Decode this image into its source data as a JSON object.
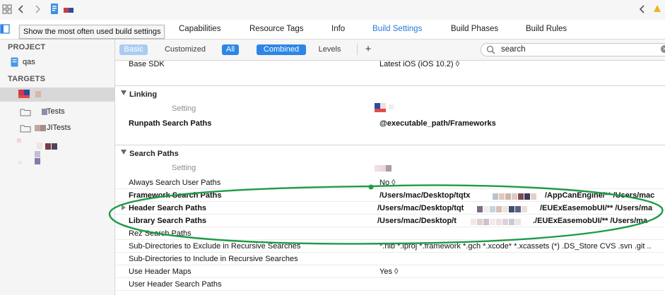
{
  "toolbar": {
    "icons": [
      "grid-icon",
      "back-chevron-icon",
      "forward-chevron-icon",
      "file-icon",
      "back-chevron-right-icon"
    ]
  },
  "tabs": [
    {
      "label": "Capabilities"
    },
    {
      "label": "Resource Tags"
    },
    {
      "label": "Info"
    },
    {
      "label": "Build Settings",
      "active": true
    },
    {
      "label": "Build Phases"
    },
    {
      "label": "Build Rules"
    }
  ],
  "tooltip": "Show the most often used build settings",
  "sidebar": {
    "project_header": "PROJECT",
    "project_item": "qas",
    "targets_header": "TARGETS",
    "targets": [
      {
        "label": ""
      },
      {
        "label": "Tests"
      },
      {
        "label": "JITests"
      }
    ]
  },
  "filter": {
    "basic": "Basic",
    "customized": "Customized",
    "all": "All",
    "combined": "Combined",
    "levels": "Levels",
    "add": "+",
    "search_value": "search"
  },
  "settings": {
    "base_sdk_label": "Base SDK",
    "base_sdk_value": "Latest iOS (iOS 10.2) ◊",
    "linking": {
      "header": "Linking",
      "setting_label": "Setting",
      "runpath_label": "Runpath Search Paths",
      "runpath_value": "@executable_path/Frameworks"
    },
    "search_paths": {
      "header": "Search Paths",
      "setting_label": "Setting",
      "rows": [
        {
          "label": "Always Search User Paths",
          "value": "No ◊",
          "bold": false
        },
        {
          "label": "Framework Search Paths",
          "value": "/Users/mac/Desktop/tqtx",
          "value_tail": "/AppCanEngine/** /Users/mac",
          "bold": true
        },
        {
          "label": "Header Search Paths",
          "value": "/Users/mac/Desktop/tqt",
          "value_tail": "/EUExEasemobUI/** /Users/ma",
          "bold": true
        },
        {
          "label": "Library Search Paths",
          "value": "/Users/mac/Desktop/t",
          "value_tail": "./EUExEasemobUI/** /Users/ma",
          "bold": true
        },
        {
          "label": "Rez Search Paths",
          "value": "",
          "bold": false
        },
        {
          "label": "Sub-Directories to Exclude in Recursive Searches",
          "value": "*.nib *.lproj *.framework *.gch *.xcode* *.xcassets (*) .DS_Store CVS .svn .git ..",
          "bold": false
        },
        {
          "label": "Sub-Directories to Include in Recursive Searches",
          "value": "",
          "bold": false
        },
        {
          "label": "Use Header Maps",
          "value": "Yes ◊",
          "bold": false
        },
        {
          "label": "User Header Search Paths",
          "value": "",
          "bold": false
        }
      ]
    }
  },
  "colors": {
    "accent": "#2d86e6",
    "annotation_ellipse": "#1f9a47"
  }
}
